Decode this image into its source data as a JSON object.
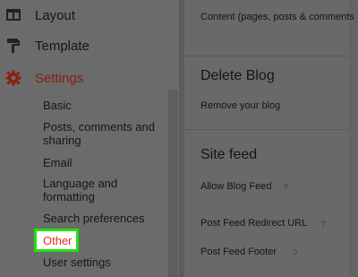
{
  "sidebar": {
    "nav": [
      {
        "label": "Layout",
        "icon": "layout-icon"
      },
      {
        "label": "Template",
        "icon": "paint-roller-icon"
      },
      {
        "label": "Settings",
        "icon": "gear-icon"
      }
    ],
    "settings_items": [
      {
        "label": "Basic"
      },
      {
        "label": "Posts, comments and sharing"
      },
      {
        "label": "Email"
      },
      {
        "label": "Language and formatting"
      },
      {
        "label": "Search preferences"
      },
      {
        "label": "Other"
      },
      {
        "label": "User settings"
      }
    ],
    "highlight_color": "#22e010",
    "active_color": "#e0311c"
  },
  "main": {
    "content_row": "Content (pages, posts & comments",
    "delete_blog": {
      "title": "Delete Blog",
      "link": "Remove your blog"
    },
    "site_feed": {
      "title": "Site feed",
      "rows": [
        {
          "label": "Allow Blog Feed",
          "help": "?"
        },
        {
          "label": "Post Feed Redirect URL",
          "help": "?"
        },
        {
          "label": "Post Feed Footer",
          "help": "?"
        }
      ]
    }
  }
}
